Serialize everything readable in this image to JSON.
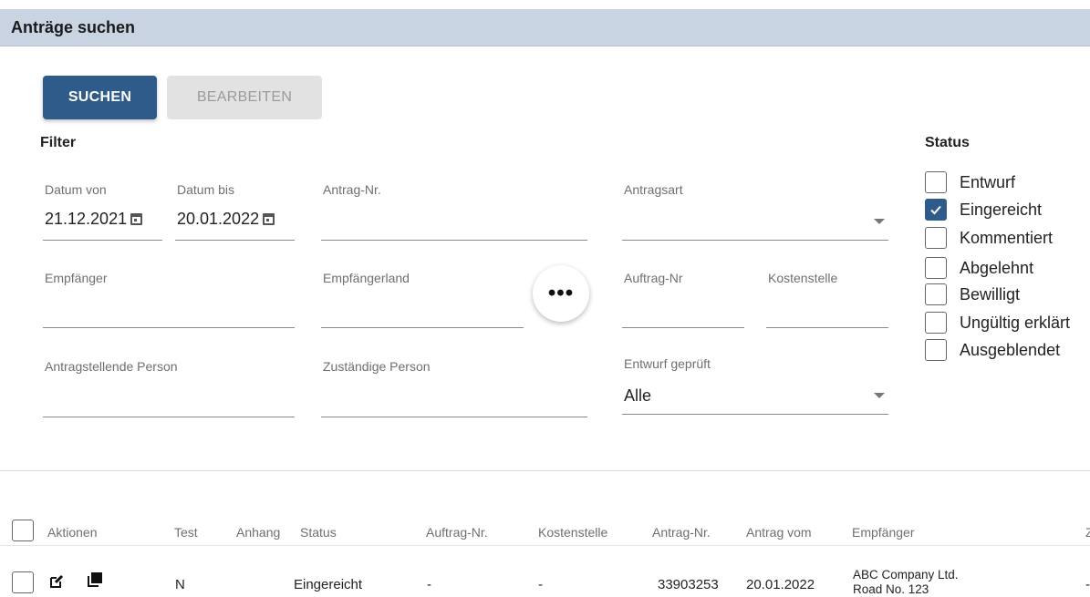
{
  "header": {
    "title": "Anträge suchen"
  },
  "actions": {
    "search_label": "SUCHEN",
    "edit_label": "BEARBEITEN"
  },
  "filter": {
    "heading": "Filter",
    "datum_von": {
      "label": "Datum von",
      "value": "21.12.2021"
    },
    "datum_bis": {
      "label": "Datum bis",
      "value": "20.01.2022"
    },
    "antrag_nr": {
      "label": "Antrag-Nr.",
      "value": ""
    },
    "antragsart": {
      "label": "Antragsart",
      "value": ""
    },
    "empfaenger": {
      "label": "Empfänger",
      "value": ""
    },
    "empfaengerland": {
      "label": "Empfängerland",
      "value": ""
    },
    "more_button": "•••",
    "auftrag_nr": {
      "label": "Auftrag-Nr",
      "value": ""
    },
    "kostenstelle": {
      "label": "Kostenstelle",
      "value": ""
    },
    "antragstellende_person": {
      "label": "Antragstellende Person",
      "value": ""
    },
    "zustaendige_person": {
      "label": "Zuständige Person",
      "value": ""
    },
    "entwurf_geprueft": {
      "label": "Entwurf geprüft",
      "value": "Alle"
    }
  },
  "status": {
    "heading": "Status",
    "options": [
      {
        "label": "Entwurf",
        "checked": false
      },
      {
        "label": "Eingereicht",
        "checked": true
      },
      {
        "label": "Kommentiert",
        "checked": false
      },
      {
        "label": "Abgelehnt",
        "checked": false
      },
      {
        "label": "Bewilligt",
        "checked": false
      },
      {
        "label": "Ungültig erklärt",
        "checked": false
      },
      {
        "label": "Ausgeblendet",
        "checked": false
      }
    ]
  },
  "table": {
    "columns": [
      "Aktionen",
      "Test",
      "Anhang",
      "Status",
      "Auftrag-Nr.",
      "Kostenstelle",
      "Antrag-Nr.",
      "Antrag vom",
      "Empfänger",
      "Z"
    ],
    "rows": [
      {
        "test": "N",
        "anhang": "",
        "status": "Eingereicht",
        "auftrag_nr": "-",
        "kostenstelle": "-",
        "antrag_nr": "33903253",
        "antrag_vom": "20.01.2022",
        "empfaenger_line1": "ABC Company Ltd.",
        "empfaenger_line2": "Road No. 123",
        "z": "-"
      }
    ]
  },
  "colors": {
    "primary": "#2f5b8a",
    "header_bg": "#c8d4e1"
  },
  "icons": [
    "calendar-icon",
    "dropdown-caret-icon",
    "more-icon",
    "check-icon",
    "edit-icon",
    "copy-icon"
  ]
}
